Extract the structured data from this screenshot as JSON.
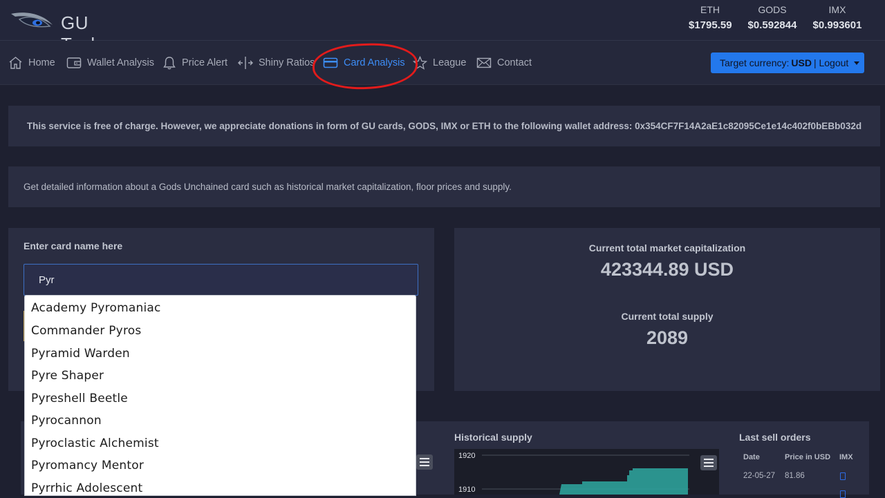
{
  "app": {
    "title": "GU Tools"
  },
  "prices": [
    {
      "label": "ETH",
      "value": "$1795.59"
    },
    {
      "label": "GODS",
      "value": "$0.592844"
    },
    {
      "label": "IMX",
      "value": "$0.993601"
    }
  ],
  "nav": {
    "items": [
      {
        "label": "Home",
        "icon": "home-icon"
      },
      {
        "label": "Wallet Analysis",
        "icon": "wallet-icon"
      },
      {
        "label": "Price Alert",
        "icon": "bell-icon"
      },
      {
        "label": "Shiny Ratios",
        "icon": "arrows-icon"
      },
      {
        "label": "Card Analysis",
        "icon": "card-icon",
        "active": true
      },
      {
        "label": "League",
        "icon": "star-icon"
      },
      {
        "label": "Contact",
        "icon": "mail-icon"
      }
    ],
    "currency": {
      "prefix": "Target currency:",
      "value": "USD",
      "suffix": "| Logout"
    }
  },
  "donation_text": "This service is free of charge. However, we appreciate donations in form of GU cards, GODS, IMX or ETH to the following wallet address: 0x354CF7F14A2aE1c82095Ce1e14c402f0bEBb032d",
  "info_text": "Get detailed information about a Gods Unchained card such as historical market capitalization, floor prices and supply.",
  "search": {
    "label": "Enter card name here",
    "value": "Pyr",
    "suggestions": [
      "Academy Pyromaniac",
      "Commander Pyros",
      "Pyramid Warden",
      "Pyre Shaper",
      "Pyreshell Beetle",
      "Pyrocannon",
      "Pyroclastic Alchemist",
      "Pyromancy Mentor",
      "Pyrrhic Adolescent"
    ]
  },
  "stats": {
    "market_cap_label": "Current total market capitalization",
    "market_cap_value": "423344.89 USD",
    "supply_label": "Current total supply",
    "supply_value": "2089"
  },
  "historical_supply": {
    "title": "Historical supply",
    "y_ticks": [
      "1920",
      "1910"
    ],
    "series_color": "#2ea8a0"
  },
  "orders": {
    "title": "Last sell orders",
    "headers": [
      "Date",
      "Price in USD",
      "IMX"
    ],
    "rows": [
      {
        "date": "22-05-27",
        "price": "81.86"
      }
    ]
  }
}
